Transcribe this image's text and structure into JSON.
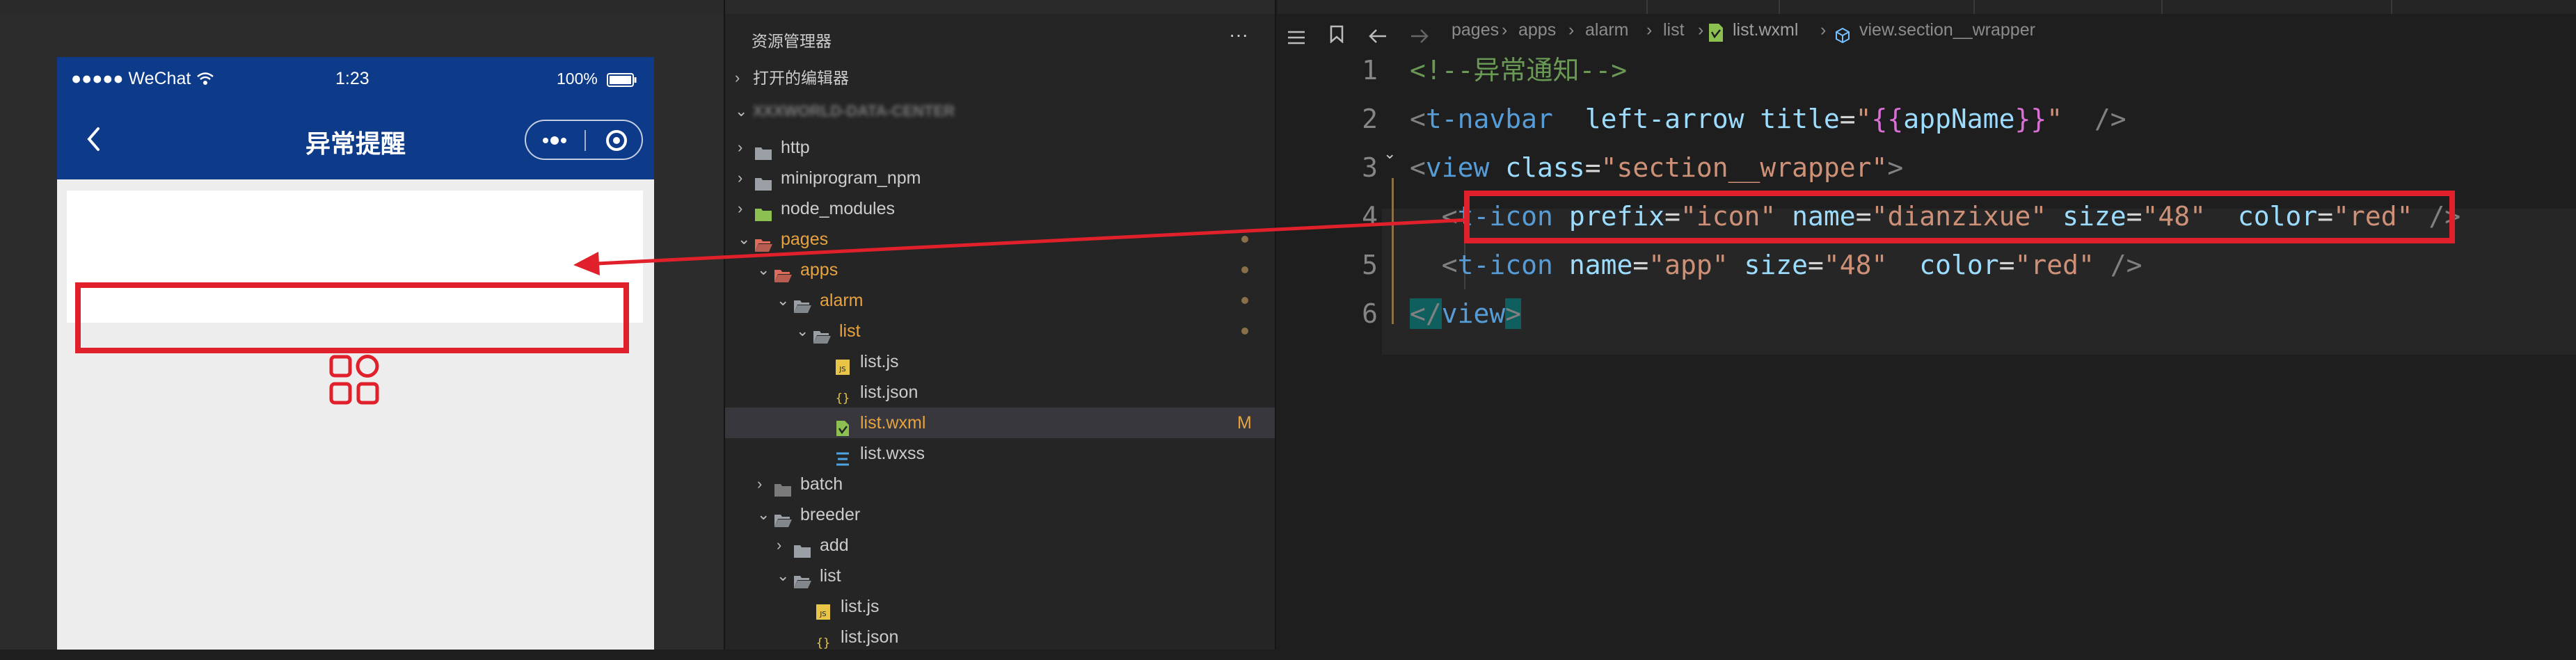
{
  "simulator": {
    "status": {
      "carrier": "●●●●● WeChat",
      "time": "1:23",
      "battery": "100%"
    },
    "navbar": {
      "title": "异常提醒"
    }
  },
  "explorer": {
    "title": "资源管理器",
    "more": "···",
    "open_editors": "打开的编辑器",
    "project_name": "XXXWORLD-DATA-CENTER",
    "items": [
      {
        "label": "http"
      },
      {
        "label": "miniprogram_npm"
      },
      {
        "label": "node_modules"
      },
      {
        "label": "pages"
      },
      {
        "label": "apps"
      },
      {
        "label": "alarm"
      },
      {
        "label": "list"
      },
      {
        "label": "list.js"
      },
      {
        "label": "list.json"
      },
      {
        "label": "list.wxml",
        "badge": "M"
      },
      {
        "label": "list.wxss"
      },
      {
        "label": "batch"
      },
      {
        "label": "breeder"
      },
      {
        "label": "add"
      },
      {
        "label": "list"
      },
      {
        "label": "list.js"
      },
      {
        "label": "list.json"
      }
    ]
  },
  "editor": {
    "breadcrumb": [
      "pages",
      "apps",
      "alarm",
      "list",
      "list.wxml",
      "view.section__wrapper"
    ],
    "code": [
      {
        "n": "1",
        "tokens": [
          {
            "t": "<!--异常通知-->",
            "c": "cmt"
          }
        ]
      },
      {
        "n": "2",
        "tokens": [
          {
            "t": "<",
            "c": "pun"
          },
          {
            "t": "t-navbar",
            "c": "tag"
          },
          {
            "t": "  ",
            "c": "txt"
          },
          {
            "t": "left-arrow",
            "c": "attr"
          },
          {
            "t": " ",
            "c": "txt"
          },
          {
            "t": "title",
            "c": "attr"
          },
          {
            "t": "=",
            "c": "txt"
          },
          {
            "t": "\"",
            "c": "str"
          },
          {
            "t": "{{",
            "c": "brace"
          },
          {
            "t": "appName",
            "c": "var"
          },
          {
            "t": "}}",
            "c": "brace"
          },
          {
            "t": "\"",
            "c": "str"
          },
          {
            "t": "  />",
            "c": "pun"
          }
        ]
      },
      {
        "n": "3",
        "tokens": [
          {
            "t": "<",
            "c": "pun"
          },
          {
            "t": "view",
            "c": "tag"
          },
          {
            "t": " ",
            "c": "txt"
          },
          {
            "t": "class",
            "c": "attr"
          },
          {
            "t": "=",
            "c": "txt"
          },
          {
            "t": "\"section__wrapper\"",
            "c": "str"
          },
          {
            "t": ">",
            "c": "pun"
          }
        ]
      },
      {
        "n": "4",
        "tokens": [
          {
            "t": "  ",
            "c": "txt"
          },
          {
            "t": "<",
            "c": "pun"
          },
          {
            "t": "t-icon",
            "c": "tag"
          },
          {
            "t": " ",
            "c": "txt"
          },
          {
            "t": "prefix",
            "c": "attr"
          },
          {
            "t": "=",
            "c": "txt"
          },
          {
            "t": "\"icon\"",
            "c": "str"
          },
          {
            "t": " ",
            "c": "txt"
          },
          {
            "t": "name",
            "c": "attr"
          },
          {
            "t": "=",
            "c": "txt"
          },
          {
            "t": "\"dianzixue\"",
            "c": "str"
          },
          {
            "t": " ",
            "c": "txt"
          },
          {
            "t": "size",
            "c": "attr"
          },
          {
            "t": "=",
            "c": "txt"
          },
          {
            "t": "\"48\"",
            "c": "str"
          },
          {
            "t": "  ",
            "c": "txt"
          },
          {
            "t": "color",
            "c": "attr"
          },
          {
            "t": "=",
            "c": "txt"
          },
          {
            "t": "\"red\"",
            "c": "str"
          },
          {
            "t": " />",
            "c": "pun"
          }
        ]
      },
      {
        "n": "5",
        "tokens": [
          {
            "t": "  ",
            "c": "txt"
          },
          {
            "t": "<",
            "c": "pun"
          },
          {
            "t": "t-icon",
            "c": "tag"
          },
          {
            "t": " ",
            "c": "txt"
          },
          {
            "t": "name",
            "c": "attr"
          },
          {
            "t": "=",
            "c": "txt"
          },
          {
            "t": "\"app\"",
            "c": "str"
          },
          {
            "t": " ",
            "c": "txt"
          },
          {
            "t": "size",
            "c": "attr"
          },
          {
            "t": "=",
            "c": "txt"
          },
          {
            "t": "\"48\"",
            "c": "str"
          },
          {
            "t": "  ",
            "c": "txt"
          },
          {
            "t": "color",
            "c": "attr"
          },
          {
            "t": "=",
            "c": "txt"
          },
          {
            "t": "\"red\"",
            "c": "str"
          },
          {
            "t": " />",
            "c": "pun"
          }
        ]
      },
      {
        "n": "6",
        "tokens": [
          {
            "t": "</",
            "c": "pun"
          },
          {
            "t": "view",
            "c": "tag"
          },
          {
            "t": ">",
            "c": "pun"
          }
        ]
      }
    ]
  },
  "colors": {
    "navbar_bg": "#0e3a8a",
    "highlight_red": "#e0202a",
    "folder_orange": "#e8a33d"
  }
}
